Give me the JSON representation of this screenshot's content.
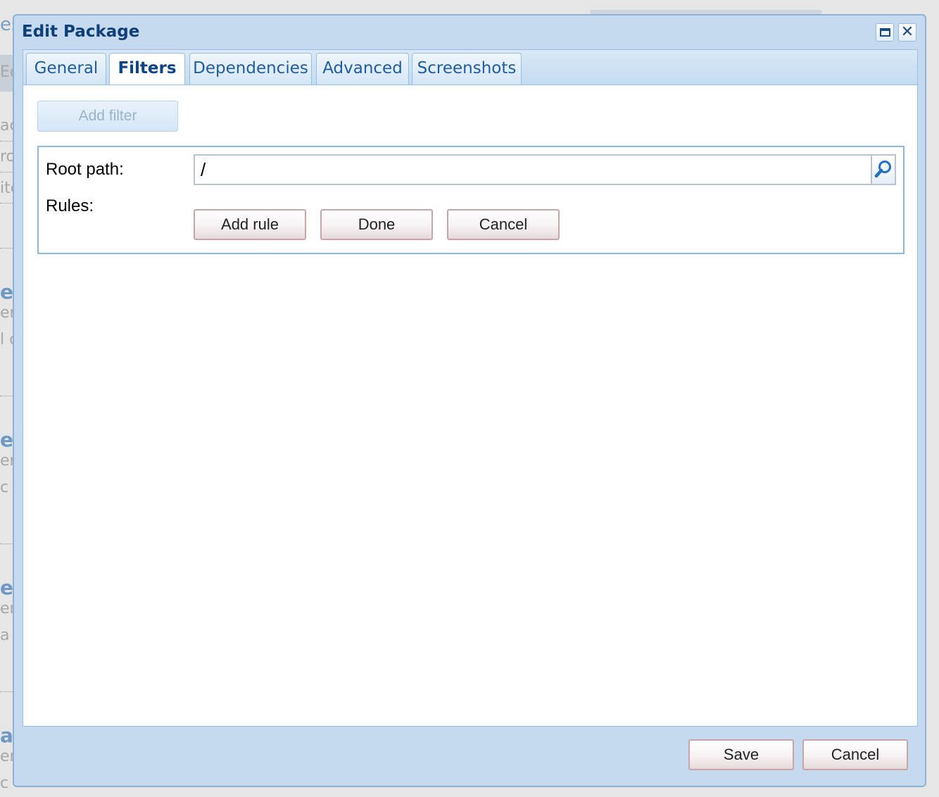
{
  "dialog": {
    "title": "Edit Package",
    "maximize_icon": "maximize-icon",
    "close_icon": "close-icon"
  },
  "tabs": [
    {
      "label": "General",
      "active": false
    },
    {
      "label": "Filters",
      "active": true
    },
    {
      "label": "Dependencies",
      "active": false
    },
    {
      "label": "Advanced",
      "active": false
    },
    {
      "label": "Screenshots",
      "active": false
    }
  ],
  "filters": {
    "add_filter_label": "Add filter",
    "root_path_label": "Root path:",
    "root_path_value": "/",
    "search_icon": "search-icon",
    "rules_label": "Rules:",
    "add_rule_label": "Add rule",
    "done_label": "Done",
    "cancel_label": "Cancel"
  },
  "footer": {
    "save_label": "Save",
    "cancel_label": "Cancel"
  },
  "colors": {
    "title": "#0f3f7a",
    "dialog_bg": "#c5daee",
    "tab_text": "#1f5da0"
  }
}
